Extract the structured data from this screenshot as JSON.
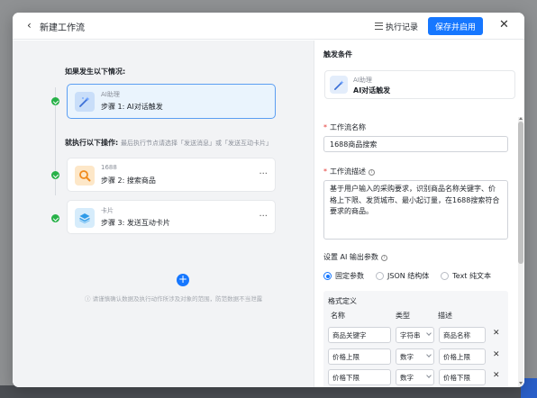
{
  "header": {
    "back_icon": "chevron-left-icon",
    "title": "新建工作流",
    "history_label": "执行记录",
    "history_icon": "list-icon",
    "save_label": "保存并启用",
    "close_icon": "close-icon",
    "accent": "#1677ff"
  },
  "canvas": {
    "condition_label": "如果发生以下情况:",
    "action_label": "就执行以下操作:",
    "action_hint": "最后执行节点请选择「发送消息」或「发送互动卡片」",
    "trigger_node": {
      "category": "AI助理",
      "step": "步骤 1:  AI对话触发",
      "icon": "ai-wand-icon"
    },
    "nodes": [
      {
        "category": "1688",
        "step": "步骤 2:  搜索商品",
        "icon": "search-magnifier-icon",
        "more": "···"
      },
      {
        "category": "卡片",
        "step": "步骤 3:  发送互动卡片",
        "icon": "card-layers-icon",
        "more": "···"
      }
    ],
    "add_icon": "plus-icon",
    "add_symbol": "+",
    "tip": "ⓘ 请谨慎确认数据及执行动作所涉及对象的范围，防范数据不当泄露",
    "status_color": "#27b148"
  },
  "panel": {
    "trigger_title": "触发条件",
    "trigger_card": {
      "category": "AI助理",
      "name": "AI对话触发"
    },
    "name_label": "工作流名称",
    "name_value": "1688商品搜索",
    "desc_label": "工作流描述",
    "desc_value": "基于用户输入的采购要求，识别商品名称关键字、价格上下限、发货城市、最小起订量，在1688搜索符合要求的商品。",
    "output_label": "设置 AI 输出参数",
    "radio_options": [
      "固定参数",
      "JSON 结构体",
      "Text 纯文本"
    ],
    "radio_selected": "固定参数",
    "format_title": "格式定义",
    "columns": [
      "名称",
      "类型",
      "描述"
    ],
    "rows": [
      {
        "name": "商品关键字",
        "type": "字符串",
        "desc": "商品名称"
      },
      {
        "name": "价格上限",
        "type": "数字",
        "desc": "价格上限"
      },
      {
        "name": "价格下限",
        "type": "数字",
        "desc": "价格下限"
      }
    ],
    "delete_symbol": "✕"
  }
}
